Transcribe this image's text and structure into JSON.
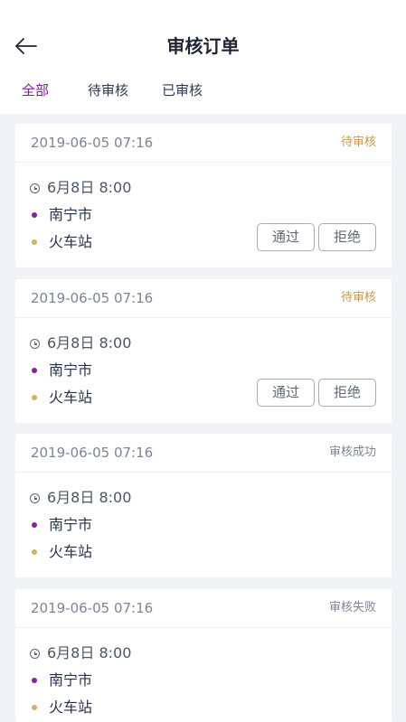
{
  "header": {
    "title": "审核订单",
    "back_icon": "arrow-left-icon"
  },
  "tabs": [
    {
      "label": "全部",
      "active": true
    },
    {
      "label": "待审核",
      "active": false
    },
    {
      "label": "已审核",
      "active": false
    }
  ],
  "colors": {
    "accent": "#7a1fa0",
    "pending": "#c29a4e",
    "done": "#7c8595",
    "origin_dot": "#8a1fa0",
    "destination_dot": "#d7ad66"
  },
  "orders": [
    {
      "created": "2019-06-05 07:16",
      "status": "待审核",
      "pickup_time": "6月8日 8:00",
      "origin": "南宁市",
      "destination": "火车站",
      "approve_label": "通过",
      "reject_label": "拒绝"
    },
    {
      "created": "2019-06-05 07:16",
      "status": "待审核",
      "pickup_time": "6月8日 8:00",
      "origin": "南宁市",
      "destination": "火车站",
      "approve_label": "通过",
      "reject_label": "拒绝"
    },
    {
      "created": "2019-06-05 07:16",
      "status": "审核成功",
      "pickup_time": "6月8日 8:00",
      "origin": "南宁市",
      "destination": "火车站"
    },
    {
      "created": "2019-06-05 07:16",
      "status": "审核失败",
      "pickup_time": "6月8日 8:00",
      "origin": "南宁市",
      "destination": "火车站"
    }
  ]
}
